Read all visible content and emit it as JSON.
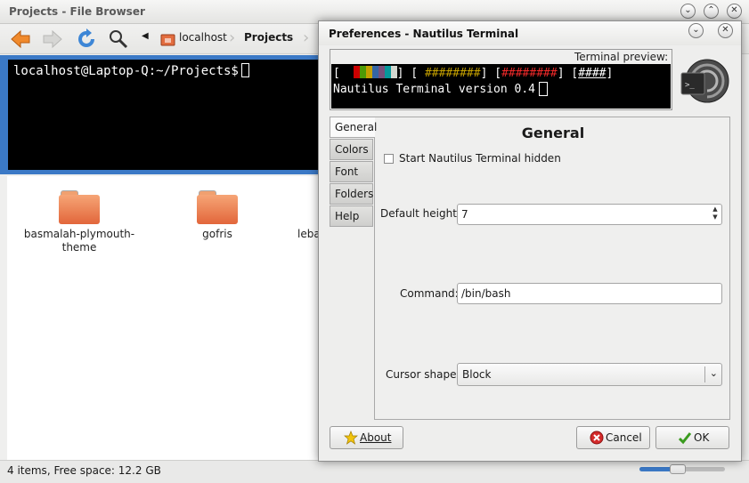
{
  "file_browser": {
    "title": "Projects - File Browser",
    "breadcrumbs": [
      "localhost",
      "Projects"
    ],
    "terminal_prompt": "localhost@Laptop-Q:~/Projects$",
    "files": [
      {
        "name": "basmalah-plymouth-\ntheme"
      },
      {
        "name": "gofris"
      },
      {
        "name": "leba"
      }
    ],
    "status": "4 items, Free space: 12.2 GB",
    "zoom_level": 0.45,
    "colors": {
      "selection": "#3b79c6",
      "folder": "#e86c3c"
    }
  },
  "dialog": {
    "title": "Preferences - Nautilus Terminal",
    "preview_label": "Terminal preview:",
    "preview_line2": "Nautilus Terminal version 0.4",
    "preview_hash_groups": [
      "########",
      "########",
      "####"
    ],
    "preview_open_bracket": "[",
    "preview_close_bracket": "]",
    "tabs": [
      "General",
      "Colors",
      "Font",
      "Folders",
      "Help"
    ],
    "active_tab": "General",
    "section_title": "General",
    "start_hidden_label": "Start Nautilus Terminal hidden",
    "start_hidden_checked": false,
    "default_height_label": "Default height:",
    "default_height_value": "7",
    "command_label": "Command:",
    "command_value": "/bin/bash",
    "cursor_shape_label": "Cursor shape:",
    "cursor_shape_value": "Block",
    "about_label": "About",
    "cancel_label": "Cancel",
    "ok_label": "OK"
  }
}
